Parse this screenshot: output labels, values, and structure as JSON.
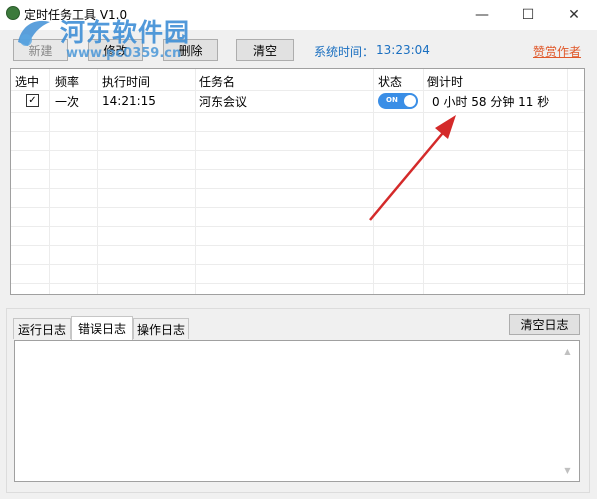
{
  "window": {
    "title": "定时任务工具 V1.0",
    "controls": {
      "minimize": "—",
      "maximize": "☐",
      "close": "✕"
    }
  },
  "watermark": {
    "name": "河东软件园",
    "url": "www.pc0359.cn"
  },
  "toolbar": {
    "new_label": "新建",
    "edit_label": "修改",
    "delete_label": "删除",
    "clear_label": "清空",
    "systime_label": "系统时间：",
    "systime_value": "13:23:04",
    "donate_label": "赞赏作者"
  },
  "grid": {
    "columns": [
      "选中",
      "频率",
      "执行时间",
      "任务名",
      "状态",
      "倒计时"
    ],
    "rows": [
      {
        "checked": true,
        "check_mark": "✓",
        "frequency": "一次",
        "time": "14:21:15",
        "name": "河东会议",
        "status": "ON",
        "countdown": "0 小时 58 分钟 11 秒"
      }
    ]
  },
  "log": {
    "tabs": [
      "运行日志",
      "错误日志",
      "操作日志"
    ],
    "active_tab": "错误日志",
    "clear_label": "清空日志",
    "scroll_up": "▲",
    "scroll_down": "▼"
  },
  "colors": {
    "accent": "#3a8ee6",
    "systime": "#1a6fc0",
    "donate": "#e0582a",
    "arrow": "#d42a2a"
  },
  "icons": [
    "app-icon",
    "watermark-logo-icon",
    "checkbox-icon",
    "annotation-arrow-icon"
  ]
}
